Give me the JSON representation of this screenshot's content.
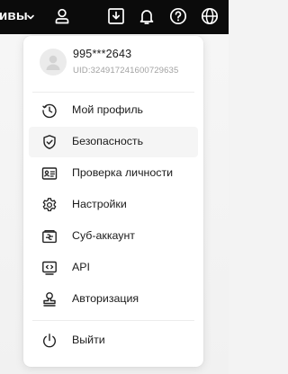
{
  "topbar": {
    "partial_text": "ивы",
    "icons": [
      "chevron-down-icon",
      "user-icon",
      "download-icon",
      "bell-icon",
      "help-icon",
      "globe-icon"
    ]
  },
  "profile": {
    "username": "995***2643",
    "uid": "UID:324917241600729635"
  },
  "menu": {
    "items": [
      {
        "label": "Мой профиль",
        "icon": "history-clock-icon"
      },
      {
        "label": "Безопасность",
        "icon": "shield-check-icon"
      },
      {
        "label": "Проверка личности",
        "icon": "id-card-icon"
      },
      {
        "label": "Настройки",
        "icon": "gear-icon"
      },
      {
        "label": "Суб-аккаунт",
        "icon": "sub-account-icon"
      },
      {
        "label": "API",
        "icon": "api-code-icon"
      },
      {
        "label": "Авторизация",
        "icon": "stamp-icon"
      }
    ],
    "logout_label": "Выйти"
  },
  "colors": {
    "topbar_bg": "#0b0b0b",
    "panel_bg": "#ffffff",
    "active_item_bg": "#f5f5f5",
    "text": "#1a1a1a",
    "muted_text": "#a2a2a2"
  }
}
